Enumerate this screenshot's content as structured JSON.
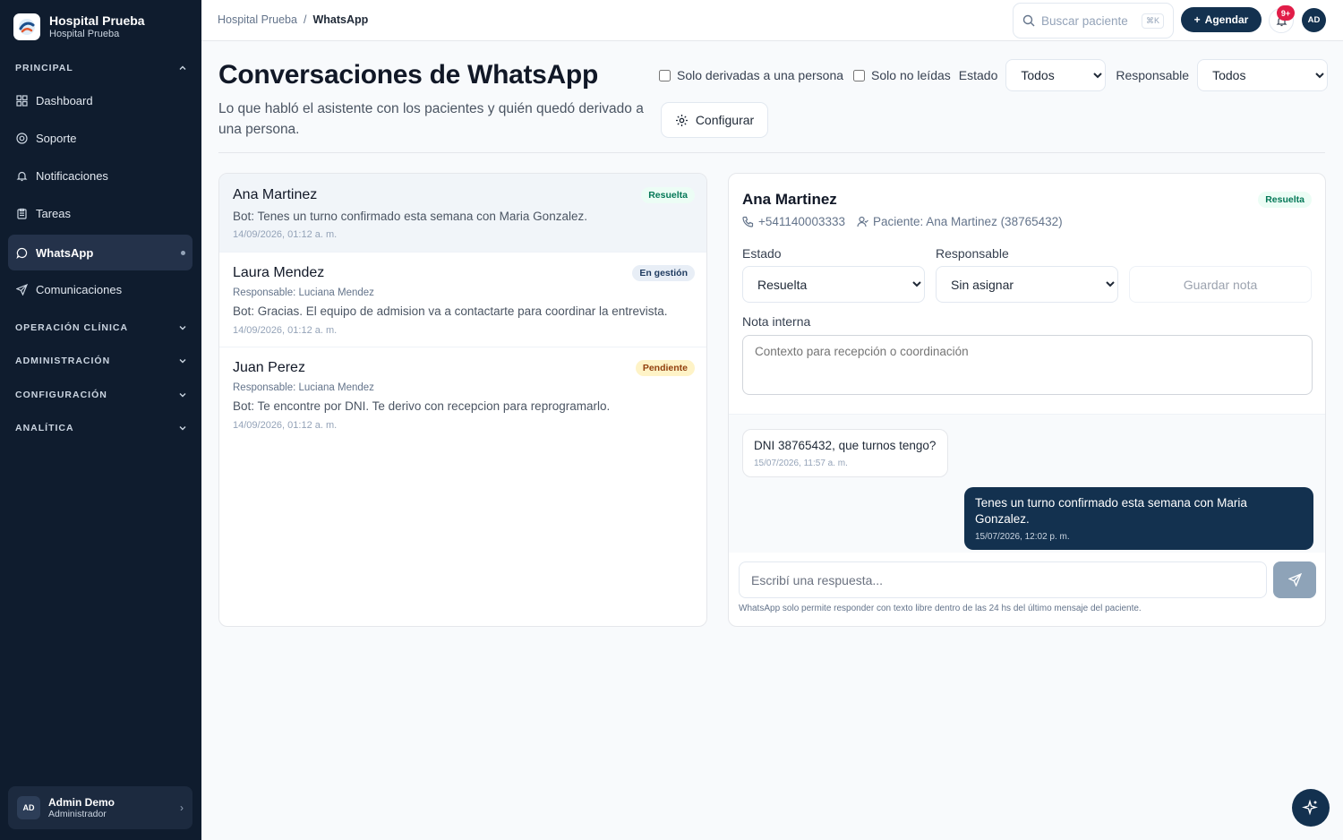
{
  "brand": {
    "title": "Hospital Prueba",
    "subtitle": "Hospital Prueba"
  },
  "sidebar": {
    "principal_label": "PRINCIPAL",
    "items": [
      {
        "label": "Dashboard",
        "icon": "grid-icon"
      },
      {
        "label": "Soporte",
        "icon": "lifebuoy-icon"
      },
      {
        "label": "Notificaciones",
        "icon": "bell-icon"
      },
      {
        "label": "Tareas",
        "icon": "clipboard-icon"
      },
      {
        "label": "WhatsApp",
        "icon": "chat-bubble-icon",
        "active": true
      },
      {
        "label": "Comunicaciones",
        "icon": "send-icon"
      }
    ],
    "sections": [
      "OPERACIÓN CLÍNICA",
      "ADMINISTRACIÓN",
      "CONFIGURACIÓN",
      "ANALÍTICA"
    ],
    "user": {
      "initials": "AD",
      "name": "Admin Demo",
      "role": "Administrador"
    }
  },
  "topbar": {
    "breadcrumb": [
      "Hospital Prueba",
      "WhatsApp"
    ],
    "search_placeholder": "Buscar paciente",
    "search_shortcut": "⌘K",
    "agendar_label": "Agendar",
    "notif_badge": "9+",
    "avatar_initials": "AD"
  },
  "page": {
    "title": "Conversaciones de WhatsApp",
    "subtitle": "Lo que habló el asistente con los pacientes y quién quedó derivado a una persona.",
    "filters": {
      "only_derived": "Solo derivadas a una persona",
      "only_unread": "Solo no leídas",
      "estado_label": "Estado",
      "estado_value": "Todos",
      "responsable_label": "Responsable",
      "responsable_value": "Todos"
    },
    "config_label": "Configurar"
  },
  "conversations": [
    {
      "name": "Ana Martinez",
      "status": "Resuelta",
      "responsable": "",
      "message": "Bot: Tenes un turno confirmado esta semana con Maria Gonzalez.",
      "time": "14/09/2026, 01:12 a. m."
    },
    {
      "name": "Laura Mendez",
      "status": "En gestión",
      "responsable": "Responsable: Luciana Mendez",
      "message": "Bot: Gracias. El equipo de admision va a contactarte para coordinar la entrevista.",
      "time": "14/09/2026, 01:12 a. m."
    },
    {
      "name": "Juan Perez",
      "status": "Pendiente",
      "responsable": "Responsable: Luciana Mendez",
      "message": "Bot: Te encontre por DNI. Te derivo con recepcion para reprogramarlo.",
      "time": "14/09/2026, 01:12 a. m."
    }
  ],
  "detail": {
    "name": "Ana Martinez",
    "status": "Resuelta",
    "phone": "+541140003333",
    "patient": "Paciente: Ana Martinez (38765432)",
    "estado_label": "Estado",
    "estado_value": "Resuelta",
    "responsable_label": "Responsable",
    "responsable_value": "Sin asignar",
    "save_note_label": "Guardar nota",
    "note_label": "Nota interna",
    "note_placeholder": "Contexto para recepción o coordinación",
    "messages": [
      {
        "text": "DNI 38765432, que turnos tengo?",
        "time": "15/07/2026, 11:57 a. m.",
        "from": "patient"
      },
      {
        "text": "Tenes un turno confirmado esta semana con Maria Gonzalez.",
        "time": "15/07/2026, 12:02 p. m.",
        "from": "bot"
      }
    ],
    "reply_placeholder": "Escribí una respuesta...",
    "hint": "WhatsApp solo permite responder con texto libre dentro de las 24 hs del último mensaje del paciente."
  },
  "colors": {
    "navy": "#13314f",
    "sidebar_bg": "#0f1c2e",
    "resuelta": "#047857",
    "pendiente": "#92400e"
  }
}
